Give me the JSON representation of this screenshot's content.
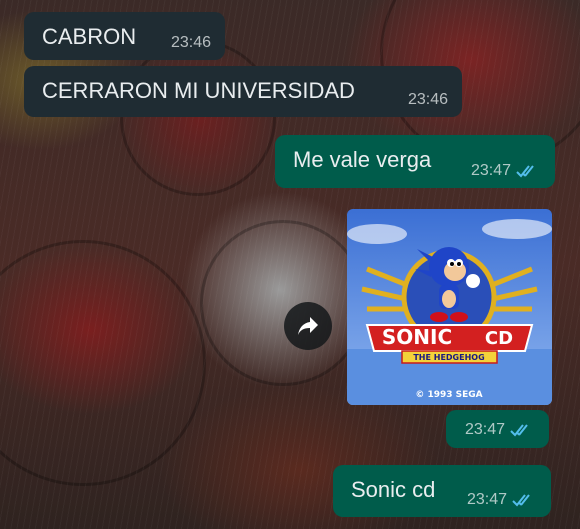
{
  "chat": {
    "messages": [
      {
        "id": "m1",
        "direction": "in",
        "text": "CABRON",
        "time": "23:46"
      },
      {
        "id": "m2",
        "direction": "in",
        "text": "CERRARON MI UNIVERSIDAD",
        "time": "23:46"
      },
      {
        "id": "m3",
        "direction": "out",
        "text": "Me vale verga",
        "time": "23:47",
        "status": "read"
      },
      {
        "id": "m4",
        "direction": "out",
        "type": "image",
        "image_text": [
          "SONIC",
          "CD",
          "THE HEDGEHOG",
          "© 1993 SEGA"
        ],
        "time": "23:47",
        "status": "read"
      },
      {
        "id": "m5",
        "direction": "out",
        "text": "Sonic cd",
        "time": "23:47",
        "status": "read"
      }
    ]
  },
  "icons": {
    "forward": "forward-arrow-icon",
    "read_receipt": "double-check-icon"
  },
  "colors": {
    "incoming_bubble": "#1f2c33",
    "outgoing_bubble": "#005c4b",
    "read_tick": "#53bdeb",
    "text": "#e9edef"
  }
}
